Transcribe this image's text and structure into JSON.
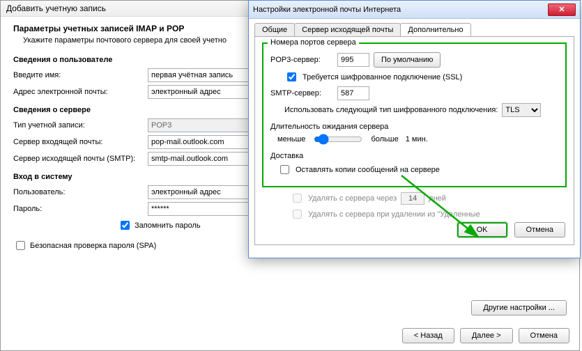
{
  "back": {
    "title": "Добавить учетную запись",
    "heading": "Параметры учетных записей IMAP и POP",
    "sub": "Укажите параметры почтового сервера для своей учетно",
    "sec_user": "Сведения о пользователе",
    "name_lbl": "Введите имя:",
    "name_val": "первая учётная запись",
    "email_lbl": "Адрес электронной почты:",
    "email_val": "электронный адрес",
    "sec_server": "Сведения о сервере",
    "type_lbl": "Тип учетной записи:",
    "type_val": "POP3",
    "in_lbl": "Сервер входящей почты:",
    "in_val": "pop-mail.outlook.com",
    "out_lbl": "Сервер исходящей почты (SMTP):",
    "out_val": "smtp-mail.outlook.com",
    "sec_login": "Вход в систему",
    "user_lbl": "Пользователь:",
    "user_val": "электронный адрес",
    "pass_lbl": "Пароль:",
    "pass_val": "******",
    "remember": "Запомнить пароль",
    "spa": "Безопасная проверка пароля (SPA)",
    "more": "Другие настройки ...",
    "back_btn": "< Назад",
    "next_btn": "Далее >",
    "cancel_btn": "Отмена"
  },
  "front": {
    "title": "Настройки электронной почты Интернета",
    "tab1": "Общие",
    "tab2": "Сервер исходящей почты",
    "tab3": "Дополнительно",
    "ports_legend": "Номера портов сервера",
    "pop3_lbl": "POP3-сервер:",
    "pop3_val": "995",
    "default_btn": "По умолчанию",
    "ssl_req": "Требуется шифрованное подключение (SSL)",
    "smtp_lbl": "SMTP-сервер:",
    "smtp_val": "587",
    "enc_lbl": "Использовать следующий тип шифрованного подключения:",
    "enc_val": "TLS",
    "timeout_head": "Длительность ожидания сервера",
    "less": "меньше",
    "more": "больше",
    "timeout_val": "1 мин.",
    "delivery_head": "Доставка",
    "leave_copy": "Оставлять копии сообщений на сервере",
    "del_after": "Удалять с сервера через",
    "days_val": "14",
    "days_lbl": "дней",
    "del_trash": "Удалять с сервера при удалении из \"Удаленные",
    "ok": "OK",
    "cancel": "Отмена"
  }
}
